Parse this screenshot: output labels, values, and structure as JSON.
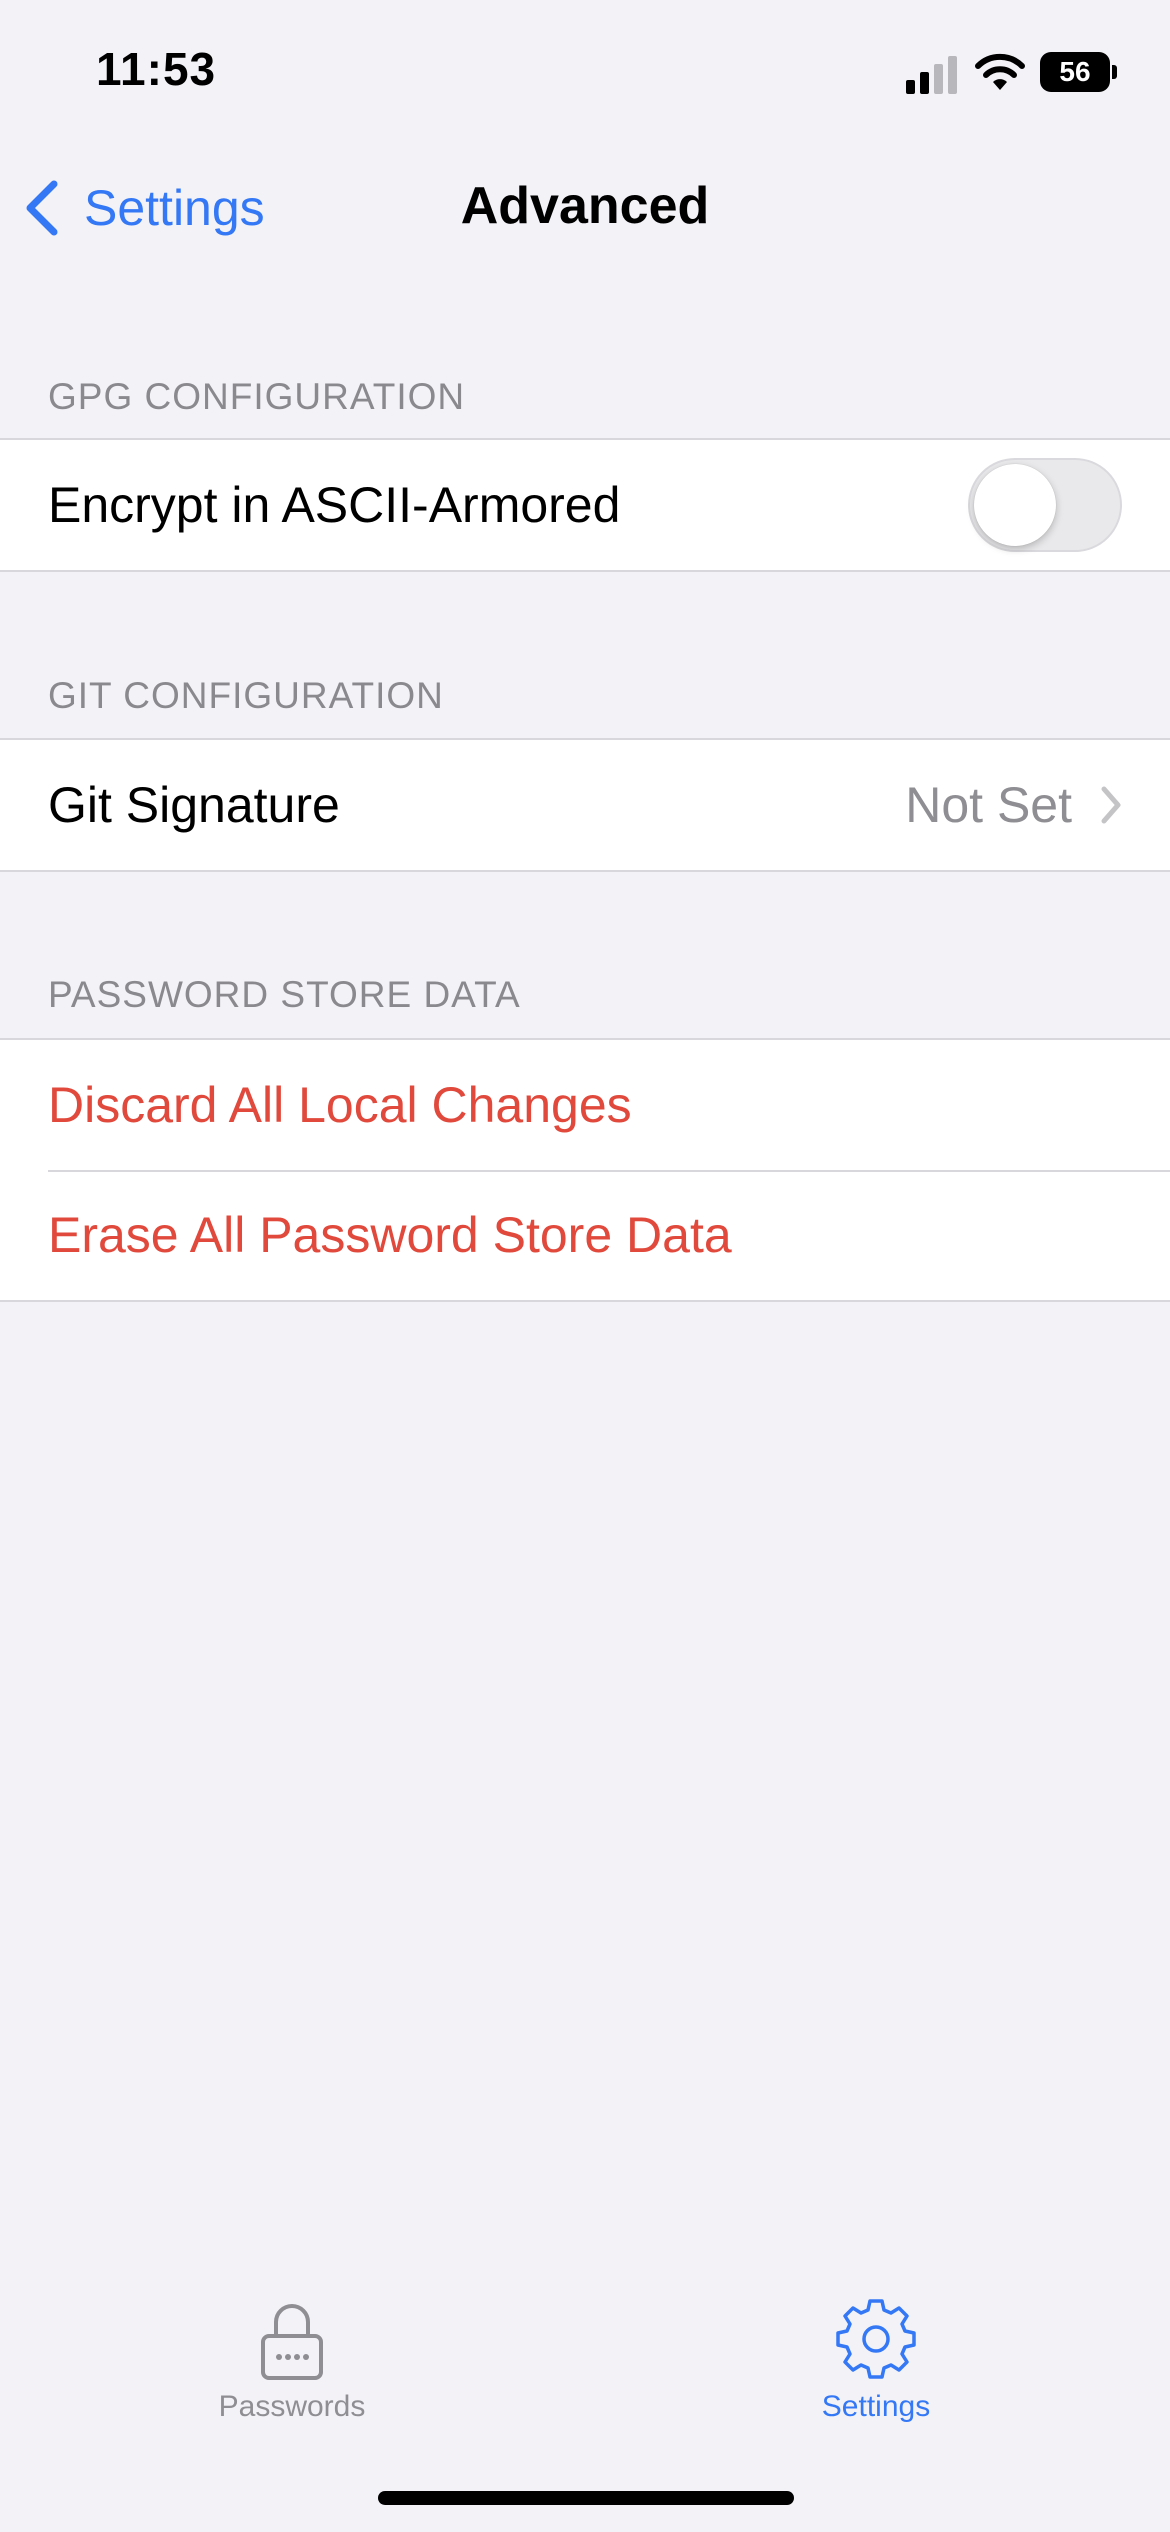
{
  "status_bar": {
    "time": "11:53",
    "battery": "56",
    "signal_bars_active": 2,
    "signal_bars_total": 4
  },
  "nav": {
    "back_label": "Settings",
    "title": "Advanced"
  },
  "sections": {
    "gpg": {
      "header": "GPG CONFIGURATION",
      "rows": [
        {
          "label": "Encrypt in ASCII-Armored",
          "toggle_on": false
        }
      ]
    },
    "git": {
      "header": "GIT CONFIGURATION",
      "rows": [
        {
          "label": "Git Signature",
          "value": "Not Set"
        }
      ]
    },
    "store": {
      "header": "PASSWORD STORE DATA",
      "rows": [
        {
          "label": "Discard All Local Changes"
        },
        {
          "label": "Erase All Password Store Data"
        }
      ]
    }
  },
  "tab_bar": {
    "tabs": [
      {
        "label": "Passwords",
        "icon": "lock-icon",
        "selected": false
      },
      {
        "label": "Settings",
        "icon": "gear-icon",
        "selected": true
      }
    ]
  },
  "colors": {
    "accent": "#3478f6",
    "destructive": "#e0493c",
    "background": "#f2f2f7",
    "secondary_text": "#8e8e93"
  }
}
